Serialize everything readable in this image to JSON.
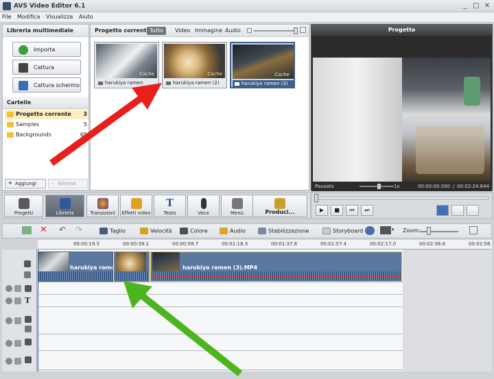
{
  "window": {
    "title": "AVS Video Editor 6.1",
    "controls": [
      "_",
      "□",
      "✕"
    ]
  },
  "menu": [
    "File",
    "Modifica",
    "Visualizza",
    "Aiuto"
  ],
  "library": {
    "header": "Libreria multimediale",
    "buttons": [
      {
        "label": "Importa",
        "icon": "plus-icon"
      },
      {
        "label": "Cattura",
        "icon": "camera-icon"
      },
      {
        "label": "Cattura schermo",
        "icon": "screen-capture-icon"
      }
    ],
    "folders_header": "Cartelle",
    "folders": [
      {
        "name": "Progetto corrente",
        "count": "3"
      },
      {
        "name": "Samples",
        "count": "5"
      },
      {
        "name": "Backgrounds",
        "count": "65"
      }
    ],
    "add_label": "Aggiungi",
    "delete_label": "Elimina"
  },
  "center": {
    "title": "Progetto corrente",
    "tabs": [
      "Tutto",
      "Video",
      "Immagine",
      "Audio"
    ],
    "active_tab": "Tutto",
    "items": [
      {
        "name": "harukiya ramen",
        "badge": "Cache"
      },
      {
        "name": "harukiya ramen (2)",
        "badge": "Cache"
      },
      {
        "name": "harukiya ramen (3)",
        "badge": "Cache"
      }
    ]
  },
  "preview": {
    "title": "Progetto",
    "status": "Pausato",
    "speed": "1x",
    "time_current": "00:00:00.000",
    "time_sep": "/",
    "time_total": "00:02:24.644"
  },
  "toolbar": {
    "items": [
      {
        "label": "Progetti",
        "icon": "projects-icon"
      },
      {
        "label": "Libreria",
        "icon": "library-icon"
      },
      {
        "label": "Transizioni",
        "icon": "transitions-icon"
      },
      {
        "label": "Effetti video",
        "icon": "video-effects-icon"
      },
      {
        "label": "Testo",
        "icon": "text-icon"
      },
      {
        "label": "Voce",
        "icon": "microphone-icon"
      },
      {
        "label": "Menù",
        "icon": "menu-icon"
      },
      {
        "label": "Produci...",
        "icon": "produce-icon"
      }
    ],
    "active": "Libreria"
  },
  "transport": [
    "▶",
    "■",
    "⏮",
    "⏭"
  ],
  "timeline_tools": {
    "items": [
      "Taglio",
      "Velocità",
      "Colore",
      "Audio",
      "Stabilizzazione"
    ],
    "storyboard": "Storyboard",
    "zoom": "Zoom:"
  },
  "ruler": [
    "00:00:19.5",
    "00:00:39.1",
    "00:00:58.7",
    "00:01:18.3",
    "00:01:37.8",
    "00:01:57.4",
    "00:02:17.0",
    "00:02:36.6",
    "00:02:56."
  ],
  "clips": [
    {
      "label": "harukiya rame..."
    },
    {
      "label": ""
    },
    {
      "label": "harukiya ramen (3).MP4"
    }
  ],
  "colors": {
    "arrow_red": "#e8201c",
    "arrow_green": "#4cb51e",
    "accent": "#2e4a72"
  }
}
